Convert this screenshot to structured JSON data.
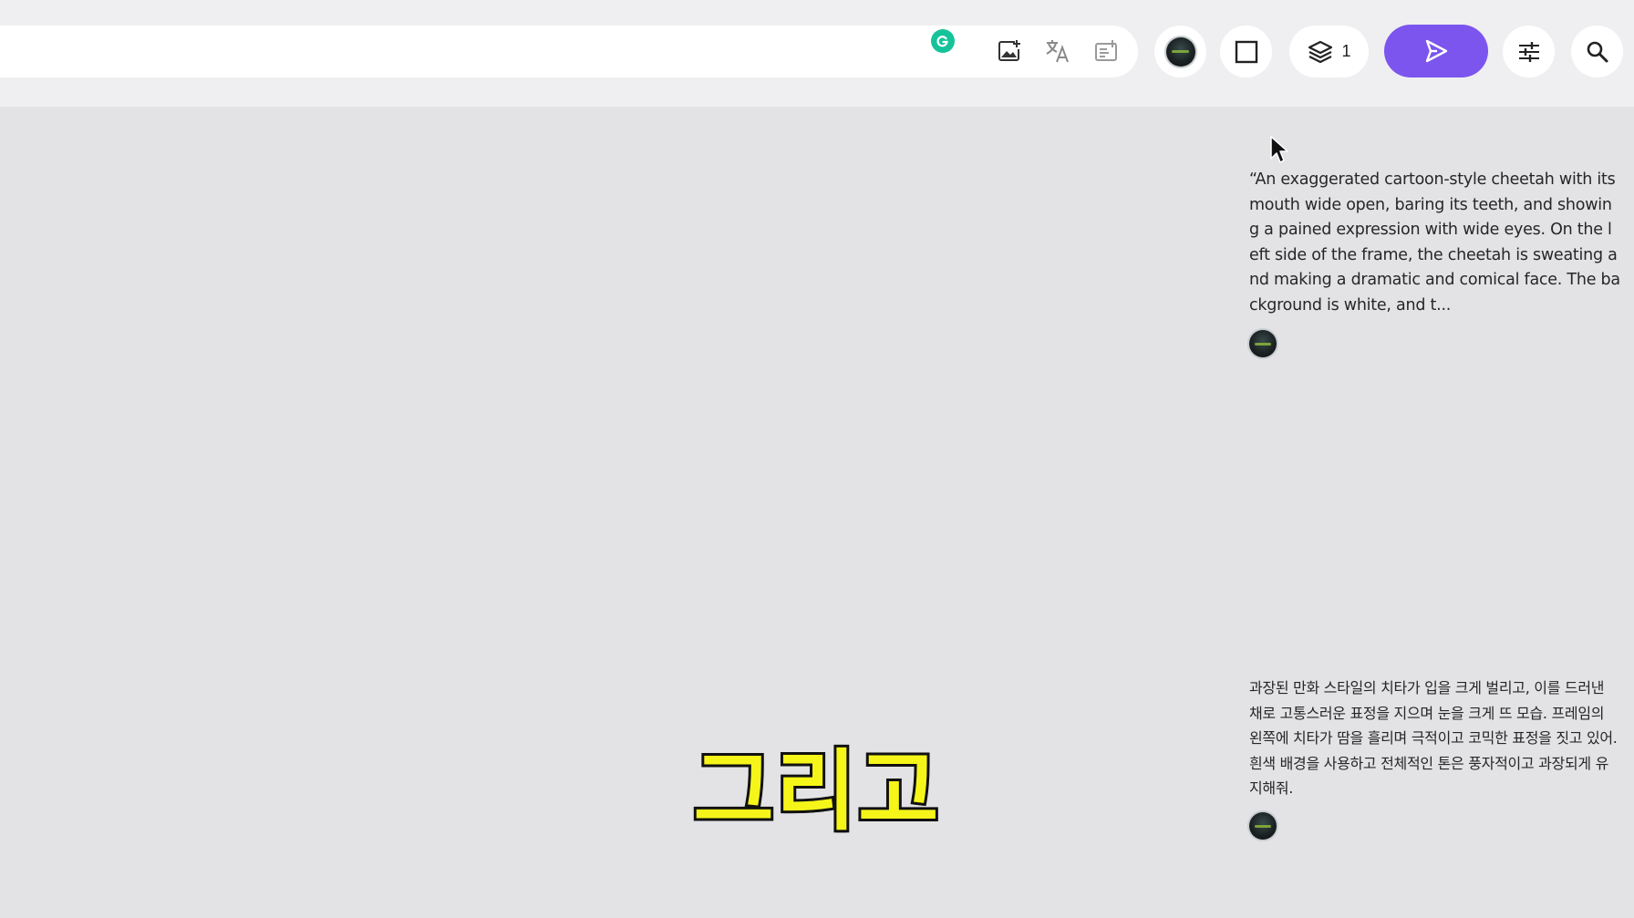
{
  "toolbar": {
    "search_value": "",
    "layers_count": "1",
    "icons": [
      "grammarly-icon",
      "add-image-icon",
      "translate-icon",
      "text-edit-icon",
      "avatar",
      "square-icon",
      "layers-icon",
      "send-icon",
      "sliders-icon",
      "search-icon"
    ],
    "accent_color": "#7b55ee"
  },
  "messages": [
    {
      "text": "“An exaggerated cartoon-style cheetah with its mouth wide open, baring its teeth, and showing a pained expression with wide eyes. On the left side of the frame, the cheetah is sweating and making a dramatic and comical face. The background is white, and t..."
    },
    {
      "text": "과장된 만화 스타일의 치타가 입을 크게 벌리고, 이를 드러낸 채로 고통스러운 표정을 지으며 눈을 크게 뜨 모습. 프레임의 왼쪽에 치타가 땀을 흘리며 극적이고 코믹한 표정을 짓고 있어. 흰색 배경을 사용하고 전체적인 톤은 풍자적이고 과장되게 유지해줘."
    }
  ],
  "caption": "그리고"
}
